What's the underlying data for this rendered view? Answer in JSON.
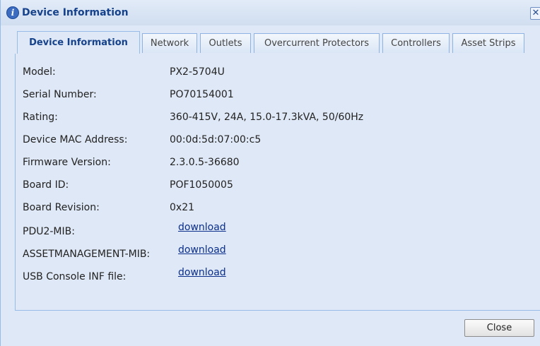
{
  "window": {
    "title": "Device Information",
    "close_glyph": "✕",
    "info_glyph": "i"
  },
  "tabs": [
    {
      "label": "Device Information"
    },
    {
      "label": "Network"
    },
    {
      "label": "Outlets"
    },
    {
      "label": "Overcurrent Protectors"
    },
    {
      "label": "Controllers"
    },
    {
      "label": "Asset Strips"
    }
  ],
  "active_tab": "Device Information",
  "details": [
    {
      "label": "Model:",
      "value": "PX2-5704U"
    },
    {
      "label": "Serial Number:",
      "value": "PO70154001"
    },
    {
      "label": "Rating:",
      "value": "360-415V, 24A, 15.0-17.3kVA, 50/60Hz"
    },
    {
      "label": "Device MAC Address:",
      "value": "00:0d:5d:07:00:c5"
    },
    {
      "label": "Firmware Version:",
      "value": "2.3.0.5-36680"
    },
    {
      "label": "Board ID:",
      "value": "POF1050005"
    },
    {
      "label": "Board Revision:",
      "value": "0x21"
    },
    {
      "label": "PDU2-MIB:",
      "link": "download"
    },
    {
      "label": "ASSETMANAGEMENT-MIB:",
      "link": "download"
    },
    {
      "label": "USB Console INF file:",
      "link": "download"
    }
  ],
  "footer": {
    "close_label": "Close"
  }
}
